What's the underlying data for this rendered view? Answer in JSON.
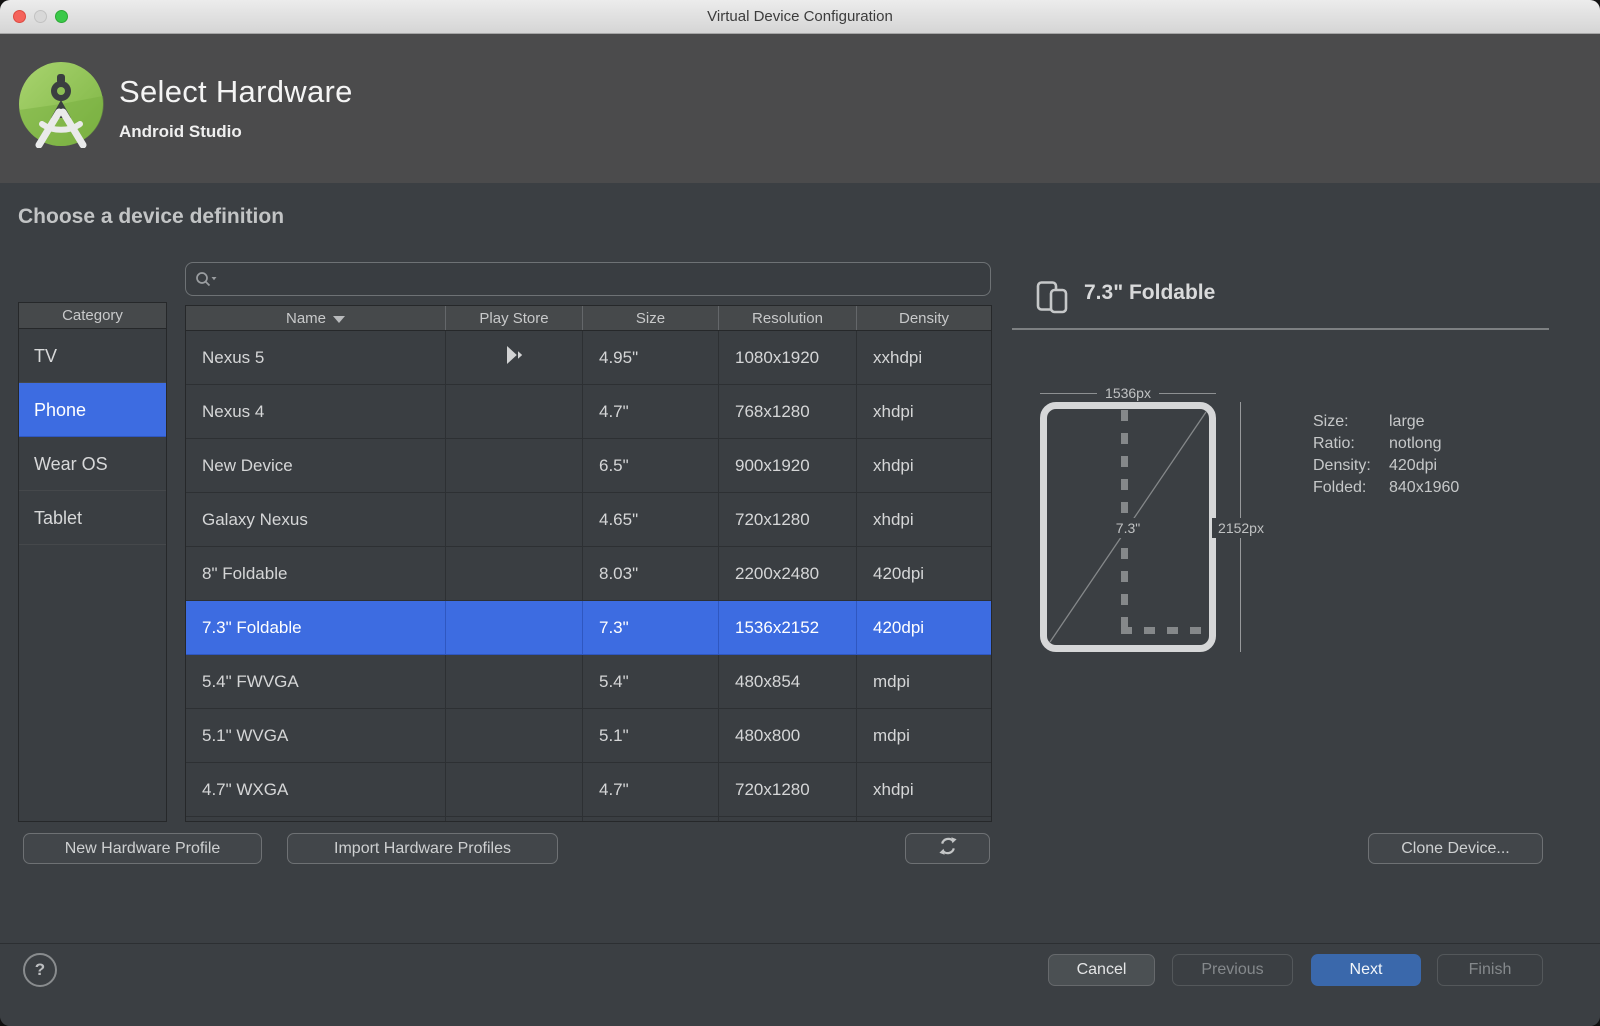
{
  "window": {
    "title": "Virtual Device Configuration"
  },
  "header": {
    "title": "Select Hardware",
    "subtitle": "Android Studio"
  },
  "section_title": "Choose a device definition",
  "search": {
    "placeholder": ""
  },
  "categories": {
    "header": "Category",
    "items": [
      {
        "label": "TV",
        "selected": false
      },
      {
        "label": "Phone",
        "selected": true
      },
      {
        "label": "Wear OS",
        "selected": false
      },
      {
        "label": "Tablet",
        "selected": false
      }
    ]
  },
  "device_table": {
    "columns": [
      "Name",
      "Play Store",
      "Size",
      "Resolution",
      "Density"
    ],
    "sort_column": "Name",
    "sort_direction": "desc",
    "rows": [
      {
        "name": "Nexus 5",
        "play_store": true,
        "size": "4.95\"",
        "resolution": "1080x1920",
        "density": "xxhdpi",
        "selected": false
      },
      {
        "name": "Nexus 4",
        "play_store": false,
        "size": "4.7\"",
        "resolution": "768x1280",
        "density": "xhdpi",
        "selected": false
      },
      {
        "name": "New Device",
        "play_store": false,
        "size": "6.5\"",
        "resolution": "900x1920",
        "density": "xhdpi",
        "selected": false
      },
      {
        "name": "Galaxy Nexus",
        "play_store": false,
        "size": "4.65\"",
        "resolution": "720x1280",
        "density": "xhdpi",
        "selected": false
      },
      {
        "name": "8\" Foldable",
        "play_store": false,
        "size": "8.03\"",
        "resolution": "2200x2480",
        "density": "420dpi",
        "selected": false
      },
      {
        "name": "7.3\" Foldable",
        "play_store": false,
        "size": "7.3\"",
        "resolution": "1536x2152",
        "density": "420dpi",
        "selected": true
      },
      {
        "name": "5.4\" FWVGA",
        "play_store": false,
        "size": "5.4\"",
        "resolution": "480x854",
        "density": "mdpi",
        "selected": false
      },
      {
        "name": "5.1\" WVGA",
        "play_store": false,
        "size": "5.1\"",
        "resolution": "480x800",
        "density": "mdpi",
        "selected": false
      },
      {
        "name": "4.7\" WXGA",
        "play_store": false,
        "size": "4.7\"",
        "resolution": "720x1280",
        "density": "xhdpi",
        "selected": false
      }
    ]
  },
  "detail": {
    "title": "7.3\" Foldable",
    "diagram": {
      "width_label": "1536px",
      "height_label": "2152px",
      "diagonal_label": "7.3\""
    },
    "specs": [
      {
        "label": "Size:",
        "value": "large"
      },
      {
        "label": "Ratio:",
        "value": "notlong"
      },
      {
        "label": "Density:",
        "value": "420dpi"
      },
      {
        "label": "Folded:",
        "value": "840x1960"
      }
    ]
  },
  "actions": {
    "new_profile": "New Hardware Profile",
    "import_profiles": "Import Hardware Profiles",
    "clone": "Clone Device..."
  },
  "footer": {
    "help": "?",
    "cancel": "Cancel",
    "previous": "Previous",
    "next": "Next",
    "finish": "Finish"
  },
  "colors": {
    "selection_blue": "#3D6CE1",
    "next_button_blue": "#3A68AB",
    "logo_green": "#8FC04C",
    "traffic_red": "#F5635B",
    "traffic_gray": "#D8D8D8",
    "traffic_green": "#3AC949"
  }
}
